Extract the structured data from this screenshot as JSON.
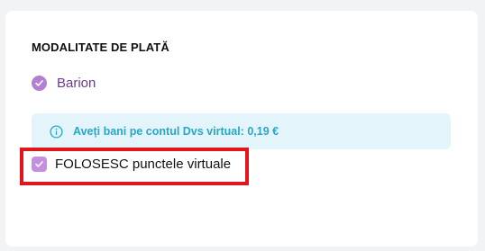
{
  "payment": {
    "section_title": "MODALITATE DE PLATĂ",
    "options": [
      {
        "label": "Barion",
        "selected": true,
        "icon": "check-circle-icon"
      }
    ],
    "info": {
      "icon": "info-circle-icon",
      "text": "Aveți bani pe contul Dvs virtual: 0,19 €"
    },
    "virtual_points": {
      "label": "FOLOSESC punctele virtuale",
      "checked": true,
      "icon": "checkbox-checked-icon"
    }
  },
  "colors": {
    "accent_purple": "#b27fd3",
    "barion_text": "#6b3a93",
    "info_bg": "#e3f5fa",
    "info_text": "#2aa6c8",
    "highlight_red": "#e3151c"
  }
}
